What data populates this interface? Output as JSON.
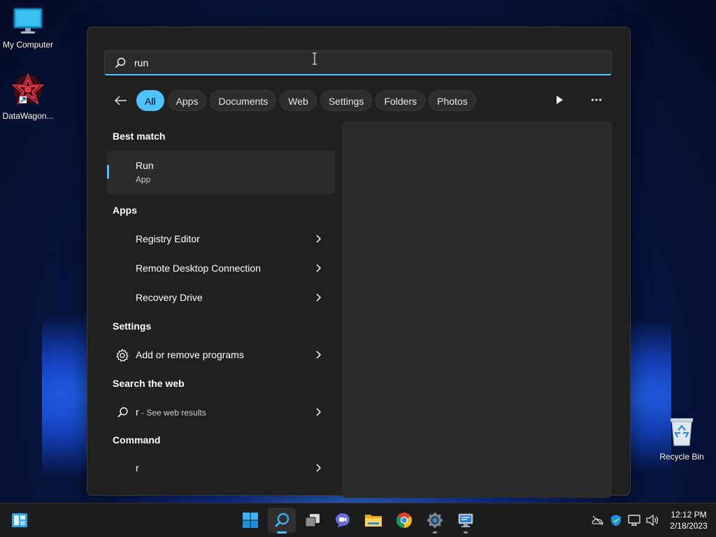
{
  "desktop": {
    "icons": [
      {
        "label": "My Computer",
        "icon": "monitor-icon"
      },
      {
        "label": "DataWagon...",
        "icon": "datawagon-app-icon"
      },
      {
        "label": "Recycle Bin",
        "icon": "recycle-bin-icon"
      }
    ]
  },
  "search": {
    "query": "run",
    "filters": [
      "All",
      "Apps",
      "Documents",
      "Web",
      "Settings",
      "Folders",
      "Photos"
    ],
    "active_filter": "All"
  },
  "results": {
    "best_match_title": "Best match",
    "best_match": {
      "name": "Run",
      "type": "App"
    },
    "apps_title": "Apps",
    "apps": [
      "Registry Editor",
      "Remote Desktop Connection",
      "Recovery Drive"
    ],
    "settings_title": "Settings",
    "settings": [
      "Add or remove programs"
    ],
    "web_title": "Search the web",
    "web": {
      "term": "r",
      "suffix": " - See web results"
    },
    "command_title": "Command",
    "command": "r"
  },
  "taskbar": {
    "apps": [
      "widgets-icon",
      "start-icon",
      "search-icon",
      "task-view-icon",
      "teams-chat-icon",
      "file-explorer-icon",
      "chrome-icon",
      "settings-icon",
      "remote-desktop-icon"
    ],
    "clock": {
      "time": "12:12 PM",
      "date": "2/18/2023"
    }
  },
  "colors": {
    "accent": "#4cc2ff",
    "panel": "#202020",
    "taskbar": "#1c1c1c"
  }
}
